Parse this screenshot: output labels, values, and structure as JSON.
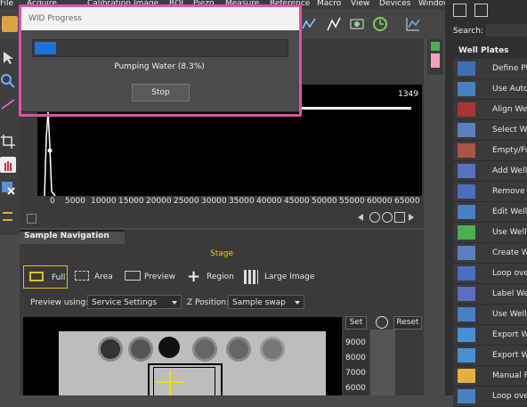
{
  "menubar": {
    "items": [
      "File",
      "Acquire",
      "Calibration",
      "Image",
      "ROI",
      "Piezo",
      "Measure",
      "Reference",
      "Macro",
      "View",
      "Devices",
      "Window"
    ]
  },
  "dialog": {
    "title": "WID Progress",
    "progress_fraction": 0.083,
    "status_text": "Pumping Water (8.3%)",
    "stop_label": "Stop",
    "accent_color": "#1a73d9"
  },
  "histogram": {
    "max_label": "1349",
    "x_ticks": [
      "0",
      "5000",
      "10000",
      "15000",
      "20000",
      "25000",
      "30000",
      "35000",
      "40000",
      "45000",
      "50000",
      "55000",
      "60000",
      "65000"
    ]
  },
  "sample_nav": {
    "tab_label": "Sample Navigation",
    "stage_label": "Stage",
    "buttons": {
      "full": "Full",
      "area": "Area",
      "preview": "Preview",
      "region": "Region",
      "large_image": "Large Image"
    },
    "preview_using_label": "Preview using:",
    "preview_using_value": "Service Settings",
    "z_position_label": "Z Position:",
    "z_position_value": "Sample swap",
    "set_label": "Set",
    "reset_label": "Reset",
    "z_ticks": [
      "9000",
      "8000",
      "7000",
      "6000"
    ]
  },
  "right_panel": {
    "search_label": "Search:",
    "section_title": "Well Plates",
    "items": [
      {
        "label": "Define Pla",
        "icon": "define-plate-icon"
      },
      {
        "label": "Use Autoc",
        "icon": "autofocus-icon"
      },
      {
        "label": "Align Wel",
        "icon": "align-wells-icon"
      },
      {
        "label": "Select We",
        "icon": "select-wells-icon"
      },
      {
        "label": "Empty/Fu",
        "icon": "empty-fill-icon"
      },
      {
        "label": "Add Well",
        "icon": "add-well-icon"
      },
      {
        "label": "Remove W",
        "icon": "remove-well-icon"
      },
      {
        "label": "Edit Well",
        "icon": "edit-well-icon"
      },
      {
        "label": "Use Well",
        "icon": "use-well-icon"
      },
      {
        "label": "Create W",
        "icon": "create-well-icon"
      },
      {
        "label": "Loop over",
        "icon": "loop-icon"
      },
      {
        "label": "Label We",
        "icon": "label-wells-icon"
      },
      {
        "label": "Use Well",
        "icon": "use-well-icon-2"
      },
      {
        "label": "Export W",
        "icon": "export-well-icon"
      },
      {
        "label": "Export W",
        "icon": "export-well-icon-2"
      },
      {
        "label": "Manual P",
        "icon": "manual-pipette-icon"
      },
      {
        "label": "Loop over",
        "icon": "loop-icon-2"
      }
    ]
  }
}
